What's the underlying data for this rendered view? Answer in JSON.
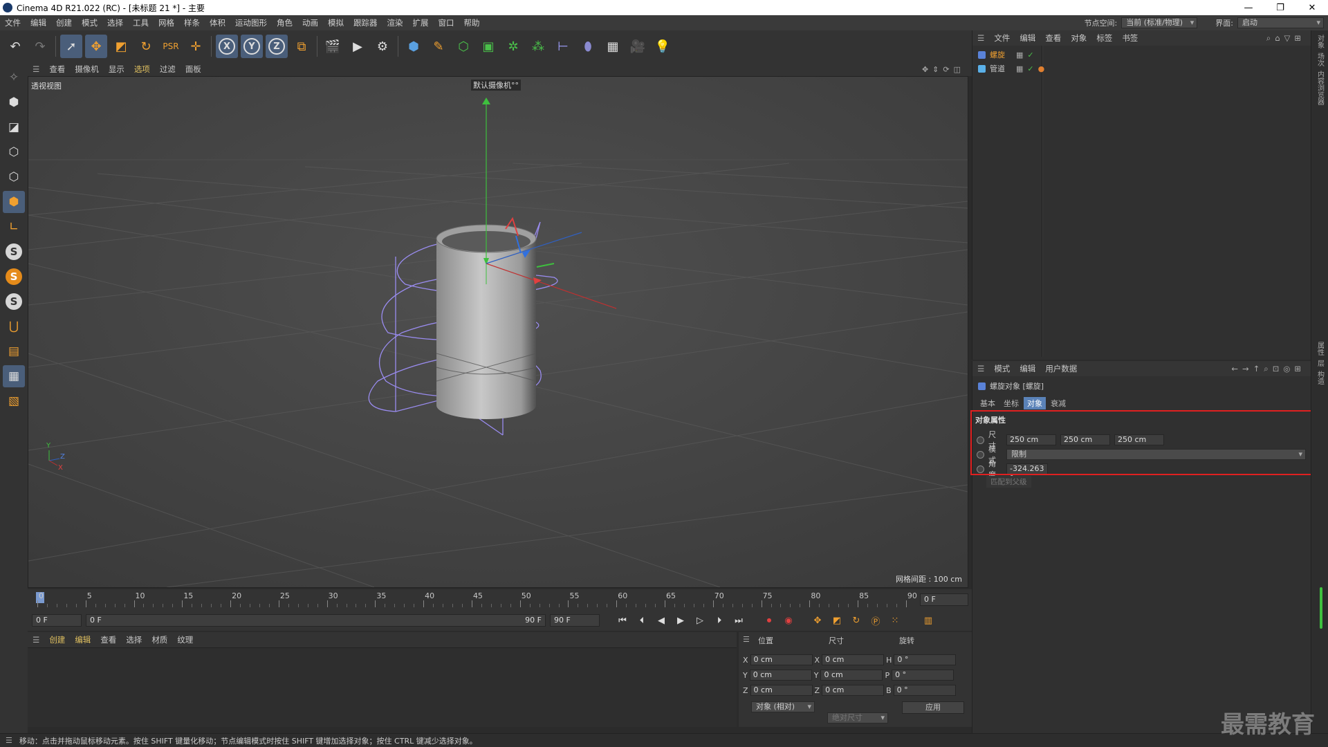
{
  "titlebar": {
    "title": "Cinema 4D R21.022 (RC) - [未标题 21 *] - 主要",
    "min": "—",
    "restore": "❐",
    "close": "✕"
  },
  "menubar": {
    "items": [
      "文件",
      "编辑",
      "创建",
      "模式",
      "选择",
      "工具",
      "网格",
      "样条",
      "体积",
      "运动图形",
      "角色",
      "动画",
      "模拟",
      "跟踪器",
      "渲染",
      "扩展",
      "窗口",
      "帮助"
    ],
    "nodespace_label": "节点空间:",
    "nodespace_value": "当前 (标准/物理)",
    "layout_label": "界面:",
    "layout_value": "启动"
  },
  "toolbar": {
    "icons": [
      "undo-icon",
      "redo-icon",
      "select-icon",
      "move-icon",
      "scale-icon",
      "rotate-icon",
      "psr-icon",
      "add-icon",
      "x-axis-icon",
      "y-axis-icon",
      "z-axis-icon",
      "coord-system-icon",
      "render-view-icon",
      "render-icon",
      "render-settings-icon",
      "cube-icon",
      "pen-icon",
      "subdivision-icon",
      "cloner-icon",
      "deformer-icon",
      "mograph-icon",
      "scene-icon",
      "field-icon",
      "floor-icon",
      "camera-icon",
      "light-icon"
    ],
    "x_axis": "X",
    "y_axis": "Y",
    "z_axis": "Z"
  },
  "left_toolbar": {
    "s_label": "S"
  },
  "viewport_menu": {
    "items": [
      "查看",
      "摄像机",
      "显示",
      "选项",
      "过滤",
      "面板"
    ],
    "highlight": "选项"
  },
  "viewport": {
    "name": "透视视图",
    "camera": "默认摄像机°°",
    "grid_spacing": "网格间距 : 100 cm",
    "axis_y": "Y",
    "axis_z": "Z",
    "axis_x": "X"
  },
  "timeline": {
    "ticks": [
      "0",
      "5",
      "10",
      "15",
      "20",
      "25",
      "30",
      "35",
      "40",
      "45",
      "50",
      "55",
      "60",
      "65",
      "70",
      "75",
      "80",
      "85",
      "90"
    ],
    "current_frame": "0 F",
    "start_field": "0 F",
    "range_start": "0 F",
    "range_end": "90 F",
    "end_field": "90 F"
  },
  "material_menu": {
    "items": [
      "创建",
      "编辑",
      "查看",
      "选择",
      "材质",
      "纹理"
    ]
  },
  "coords": {
    "headers": [
      "位置",
      "尺寸",
      "旋转"
    ],
    "rows": [
      {
        "a": "X",
        "pos": "0 cm",
        "b": "X",
        "size": "0 cm",
        "c": "H",
        "rot": "0 °"
      },
      {
        "a": "Y",
        "pos": "0 cm",
        "b": "Y",
        "size": "0 cm",
        "c": "P",
        "rot": "0 °"
      },
      {
        "a": "Z",
        "pos": "0 cm",
        "b": "Z",
        "size": "0 cm",
        "c": "B",
        "rot": "0 °"
      }
    ],
    "mode": "对象 (相对)",
    "size_mode": "绝对尺寸",
    "apply": "应用"
  },
  "object_manager": {
    "menu": [
      "文件",
      "编辑",
      "查看",
      "对象",
      "标签",
      "书签"
    ],
    "objects": [
      {
        "name": "螺旋",
        "selected": true
      },
      {
        "name": "管道",
        "selected": false
      }
    ]
  },
  "attribute_manager": {
    "menu": [
      "模式",
      "编辑",
      "用户数据"
    ],
    "object_title": "螺旋对象 [螺旋]",
    "tabs": [
      "基本",
      "坐标",
      "对象",
      "衰减"
    ],
    "active_tab": "对象",
    "section": "对象属性",
    "size_label": "尺寸",
    "size_values": [
      "250 cm",
      "250 cm",
      "250 cm"
    ],
    "mode_label": "模式",
    "mode_value": "限制",
    "angle_label": "角度",
    "angle_value": "-324.263 °",
    "match_button": "匹配到父级"
  },
  "right_strip": {
    "tabs": [
      "对象",
      "场次",
      "内容浏览器"
    ],
    "tabs2": [
      "属性",
      "层",
      "构造"
    ]
  },
  "statusbar": {
    "text": "移动：点击并拖动鼠标移动元素。按住 SHIFT 键量化移动；节点编辑模式时按住 SHIFT 键增加选择对象；按住 CTRL 键减少选择对象。"
  },
  "watermark": "最需教育",
  "colors": {
    "accent": "#5a82b8",
    "highlight_box": "#e02020",
    "spline": "#9a8cf0",
    "menu_highlight": "#e0c060"
  }
}
